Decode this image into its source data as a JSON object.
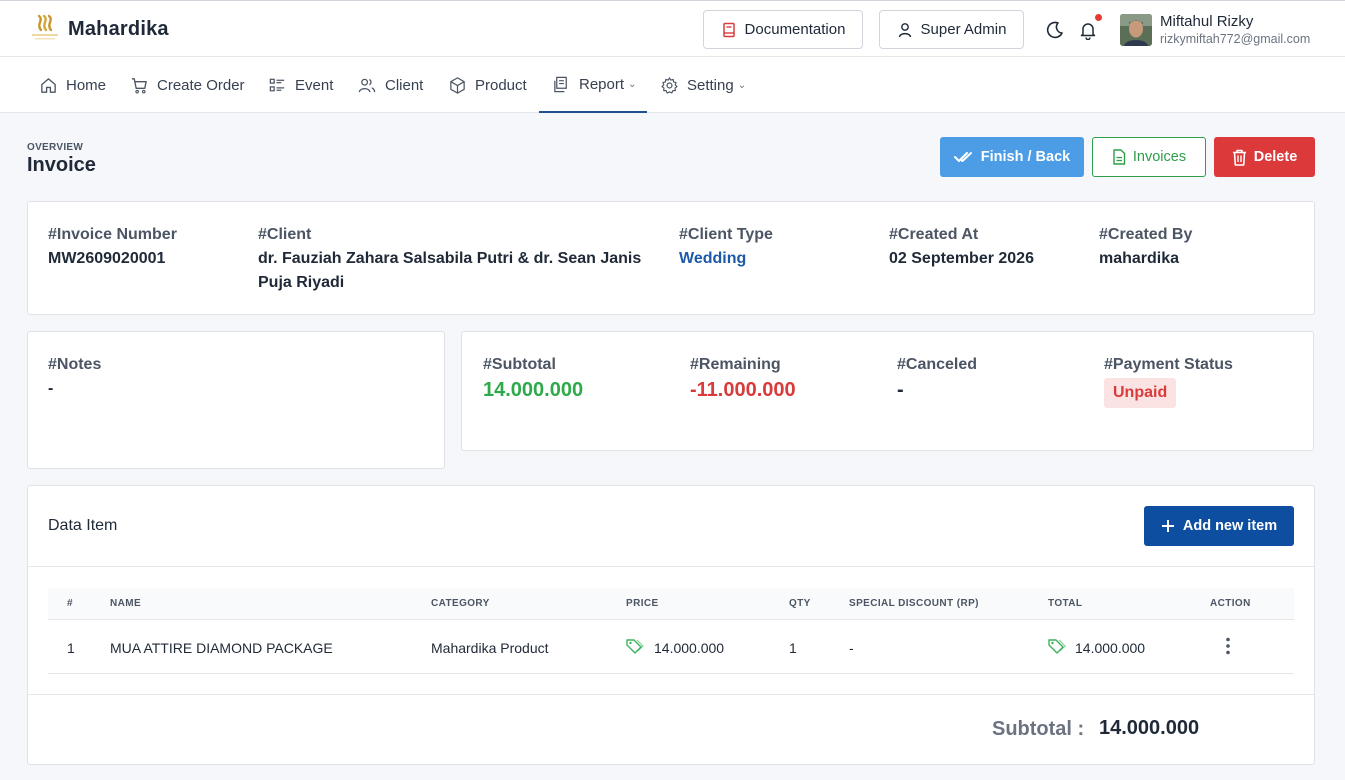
{
  "brand": {
    "name": "Mahardika"
  },
  "header": {
    "documentation_label": "Documentation",
    "role_label": "Super Admin",
    "user": {
      "name": "Miftahul Rizky",
      "email": "rizkymiftah772@gmail.com"
    }
  },
  "nav": {
    "items": [
      {
        "label": "Home",
        "icon": "home-icon"
      },
      {
        "label": "Create Order",
        "icon": "cart-icon"
      },
      {
        "label": "Event",
        "icon": "list-icon"
      },
      {
        "label": "Client",
        "icon": "users-icon"
      },
      {
        "label": "Product",
        "icon": "box-icon"
      },
      {
        "label": "Report",
        "icon": "report-icon",
        "dropdown": true,
        "active": true
      },
      {
        "label": "Setting",
        "icon": "gear-icon",
        "dropdown": true
      }
    ]
  },
  "page": {
    "overview_label": "OVERVIEW",
    "title": "Invoice",
    "actions": {
      "finish": "Finish / Back",
      "invoices": "Invoices",
      "delete": "Delete"
    }
  },
  "invoice": {
    "labels": {
      "number": "#Invoice Number",
      "client": "#Client",
      "client_type": "#Client Type",
      "created_at": "#Created At",
      "created_by": "#Created By",
      "notes": "#Notes",
      "subtotal": "#Subtotal",
      "remaining": "#Remaining",
      "canceled": "#Canceled",
      "payment_status": "#Payment Status"
    },
    "number": "MW2609020001",
    "client_line1": "dr. Fauziah Zahara Salsabila Putri & dr. Sean Janis",
    "client_line2": "Puja Riyadi",
    "client_type": "Wedding",
    "created_at": "02 September 2026",
    "created_by": "mahardika",
    "notes": "-",
    "subtotal": "14.000.000",
    "remaining": "-11.000.000",
    "canceled": "-",
    "payment_status": "Unpaid"
  },
  "items": {
    "title": "Data Item",
    "add_label": "Add new item",
    "columns": [
      "#",
      "NAME",
      "CATEGORY",
      "PRICE",
      "QTY",
      "SPECIAL DISCOUNT (RP)",
      "TOTAL",
      "ACTION"
    ],
    "rows": [
      {
        "no": "1",
        "name": "MUA ATTIRE DIAMOND PACKAGE",
        "category": "Mahardika Product",
        "price": "14.000.000",
        "qty": "1",
        "discount": "-",
        "total": "14.000.000"
      }
    ],
    "subtotal_label": "Subtotal :",
    "subtotal_value": "14.000.000"
  },
  "colors": {
    "primary": "#0e4ea0",
    "finish": "#4d9ce6",
    "success": "#2eaa4a",
    "danger": "#dc3a3a",
    "link": "#1d5aa8"
  }
}
